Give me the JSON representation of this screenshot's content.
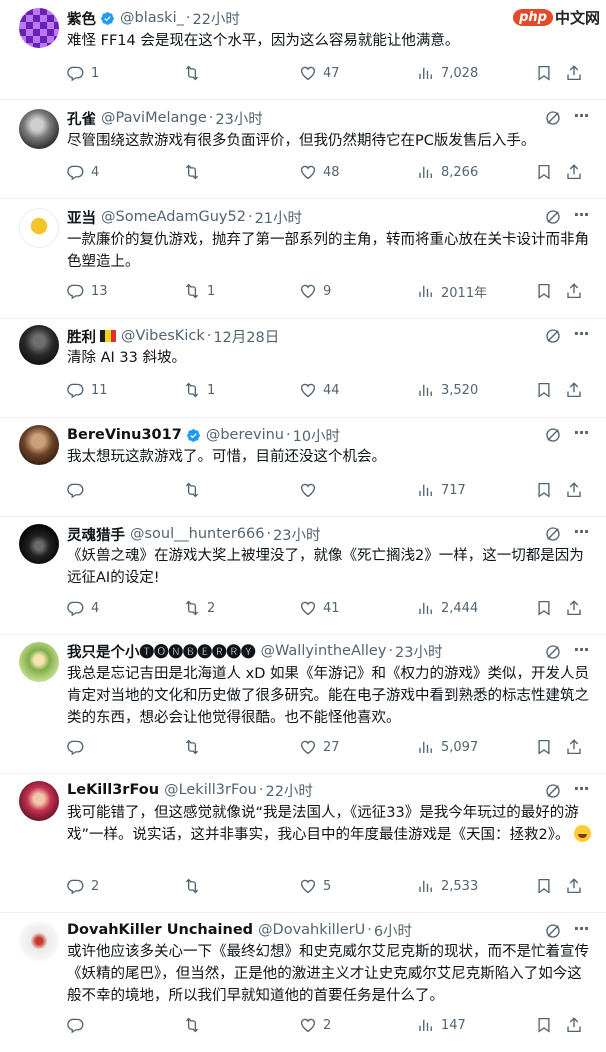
{
  "watermark": {
    "logo": "php",
    "text": "中文网"
  },
  "tweets": [
    {
      "name": "紫色",
      "verified": true,
      "handle": "@blaski_",
      "time": "22小时",
      "text": "难怪 FF14 会是现在这个水平，因为这么容易就能让他满意。",
      "replies": "1",
      "retweets": "",
      "likes": "47",
      "views": "7,028",
      "avatar_icon": "avatar-image"
    },
    {
      "name": "孔雀",
      "verified": false,
      "handle": "@PaviMelange",
      "time": "23小时",
      "text": "尽管围绕这款游戏有很多负面评价，但我仍然期待它在PC版发售后入手。",
      "replies": "4",
      "retweets": "",
      "likes": "48",
      "views": "8,266",
      "avatar_icon": "avatar-image"
    },
    {
      "name": "亚当",
      "verified": false,
      "handle": "@SomeAdamGuy52",
      "time": "21小时",
      "text": "一款廉价的复仇游戏，抛弃了第一部系列的主角，转而将重心放在关卡设计而非角色塑造上。",
      "replies": "13",
      "retweets": "1",
      "likes": "9",
      "views": "2011年",
      "avatar_icon": "trophy-avatar"
    },
    {
      "name": "胜利",
      "verified": false,
      "flag": true,
      "handle": "@VibesKick",
      "time": "12月28日",
      "text": "清除 AI 33 斜坡。",
      "replies": "11",
      "retweets": "1",
      "likes": "44",
      "views": "3,520",
      "avatar_icon": "avatar-image"
    },
    {
      "name": "BereVinu3017",
      "verified": true,
      "handle": "@berevinu",
      "time": "10小时",
      "text": "我太想玩这款游戏了。可惜，目前还没这个机会。",
      "replies": "",
      "retweets": "",
      "likes": "",
      "views": "717",
      "avatar_icon": "avatar-image"
    },
    {
      "name": "灵魂猎手",
      "verified": false,
      "handle": "@soul__hunter666",
      "time": "23小时",
      "text": "《妖兽之魂》在游戏大奖上被埋没了，就像《死亡搁浅2》一样，这一切都是因为远征AI的设定!",
      "replies": "4",
      "retweets": "2",
      "likes": "41",
      "views": "2,444",
      "avatar_icon": "avatar-image"
    },
    {
      "name": "我只是个小🅣🅞🅝🅑🅔🅡🅡🅨",
      "verified": false,
      "handle": "@WallyintheAlley",
      "time": "23小时",
      "text": "我总是忘记吉田是北海道人 xD 如果《年游记》和《权力的游戏》类似，开发人员肯定对当地的文化和历史做了很多研究。能在电子游戏中看到熟悉的标志性建筑之类的东西，想必会让他觉得很酷。也不能怪他喜欢。",
      "replies": "",
      "retweets": "",
      "likes": "27",
      "views": "5,097",
      "avatar_icon": "avatar-image"
    },
    {
      "name": "LeKill3rFou",
      "verified": false,
      "handle": "@Lekill3rFou",
      "time": "22小时",
      "text": "我可能错了，但这感觉就像说“我是法国人，《远征33》是我今年玩过的最好的游戏”一样。说实话，这并非事实，我心目中的年度最佳游戏是《天国：拯救2》。",
      "replies": "2",
      "retweets": "",
      "likes": "5",
      "views": "2,533",
      "avatar_icon": "avatar-image"
    },
    {
      "name": "DovahKiller Unchained",
      "verified": false,
      "handle": "@DovahkillerU",
      "time": "6小时",
      "text": "或许他应该多关心一下《最终幻想》和史克威尔艾尼克斯的现状，而不是忙着宣传《妖精的尾巴》，但当然，正是他的激进主义才让史克威尔艾尼克斯陷入了如今这般不幸的境地，所以我们早就知道他的首要任务是什么了。",
      "replies": "",
      "retweets": "",
      "likes": "2",
      "views": "147",
      "avatar_icon": "avatar-image"
    }
  ]
}
